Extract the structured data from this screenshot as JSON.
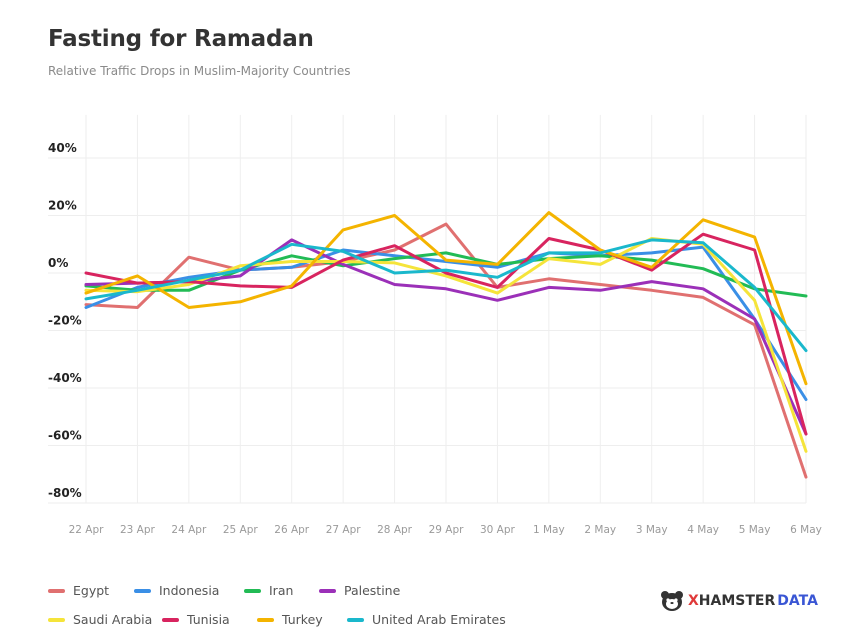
{
  "header": {
    "title": "Fasting for Ramadan",
    "subtitle": "Relative Traffic Drops in Muslim-Majority Countries"
  },
  "logo": {
    "icon": "hamster-face-icon",
    "x": "X",
    "hamster": "HAMSTER",
    "data": "DATA"
  },
  "chart_data": {
    "type": "line",
    "title": "Fasting for Ramadan",
    "subtitle": "Relative Traffic Drops in Muslim-Majority Countries",
    "xlabel": "",
    "ylabel": "",
    "categories": [
      "22 Apr",
      "23 Apr",
      "24 Apr",
      "25 Apr",
      "26 Apr",
      "27 Apr",
      "28 Apr",
      "29 Apr",
      "30 Apr",
      "1 May",
      "2 May",
      "3 May",
      "4 May",
      "5 May",
      "6 May"
    ],
    "y_ticks": [
      40,
      20,
      0,
      -20,
      -40,
      -60,
      -80
    ],
    "y_tick_labels": [
      "40%",
      "20%",
      "0%",
      "-20%",
      "-40%",
      "-60%",
      "-80%"
    ],
    "ylim": [
      -80,
      55
    ],
    "grid": true,
    "legend_position": "bottom-left",
    "series": [
      {
        "name": "Egypt",
        "color": "#e07070",
        "values": [
          -11,
          -12,
          5.5,
          1,
          2,
          4,
          8,
          17,
          -5,
          -2,
          -4,
          -6,
          -8.5,
          -18,
          -71
        ]
      },
      {
        "name": "Indonesia",
        "color": "#3a8fe6",
        "values": [
          -12,
          -5,
          -1.5,
          1,
          2,
          8,
          6,
          4,
          2,
          7,
          6,
          7,
          9,
          -16,
          -44
        ]
      },
      {
        "name": "Iran",
        "color": "#22bb55",
        "values": [
          -4.5,
          -6,
          -6,
          1,
          6,
          2.5,
          5,
          7,
          3,
          5,
          6,
          4.5,
          1.5,
          -5.5,
          -8
        ]
      },
      {
        "name": "Palestine",
        "color": "#9b30b8",
        "values": [
          -4,
          -3.5,
          -3,
          -1,
          11.5,
          3,
          -4,
          -5.5,
          -9.5,
          -5,
          -6,
          -3,
          -5.5,
          -16,
          -56
        ]
      },
      {
        "name": "Saudi Arabia",
        "color": "#f5e43a",
        "values": [
          -6,
          -6.5,
          -4,
          2.5,
          4,
          4,
          3.5,
          -1,
          -7,
          5,
          3,
          12,
          10,
          -9.5,
          -62
        ]
      },
      {
        "name": "Tunisia",
        "color": "#d8245f",
        "values": [
          0,
          -3.5,
          -3,
          -4.5,
          -5,
          4.5,
          9.5,
          0,
          -5,
          12,
          8,
          1,
          13.5,
          8,
          -56
        ]
      },
      {
        "name": "Turkey",
        "color": "#f4b400",
        "values": [
          -7,
          -1,
          -12,
          -10,
          -4.5,
          15,
          20,
          4.5,
          3,
          21,
          8,
          2,
          18.5,
          12.5,
          -38.5
        ]
      },
      {
        "name": "United Arab Emirates",
        "color": "#1ab8cc",
        "values": [
          -9,
          -6,
          -2.5,
          1,
          10,
          7.5,
          0,
          1,
          -1.5,
          7,
          7,
          11.5,
          10.5,
          -5,
          -27
        ]
      }
    ]
  }
}
